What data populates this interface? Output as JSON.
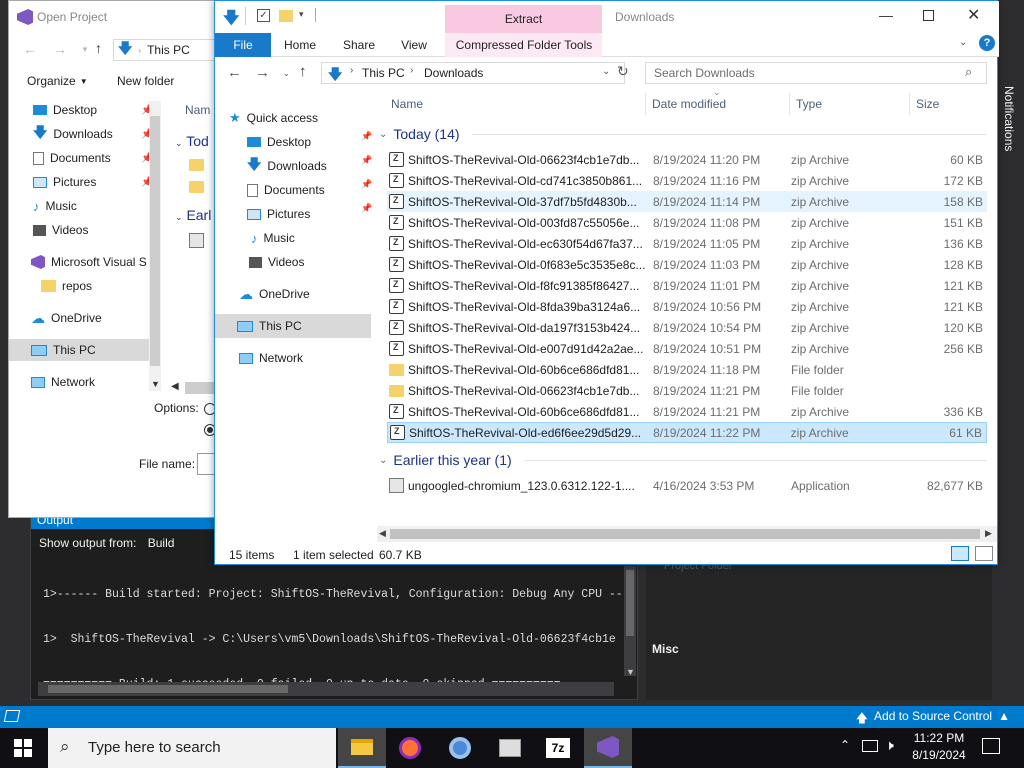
{
  "vs": {
    "output_title": "Output",
    "show_output_label": "Show output from:",
    "show_output_value": "Build",
    "output_lines": [
      "1>------ Build started: Project: ShiftOS-TheRevival, Configuration: Debug Any CPU ------",
      "1>  ShiftOS-TheRevival -> C:\\Users\\vm5\\Downloads\\ShiftOS-TheRevival-Old-06623f4cb1e",
      "========== Build: 1 succeeded, 0 failed, 0 up-to-date, 0 skipped =========="
    ],
    "props_misc": "Misc",
    "props_faded": "Project Folder",
    "status_source_control": "Add to Source Control",
    "notifications": "Notifications"
  },
  "open_project": {
    "title": "Open Project",
    "breadcrumb": "This PC",
    "organize": "Organize",
    "new_folder": "New folder",
    "nav": [
      {
        "label": "Desktop",
        "icon": "desktop-icon",
        "pinned": true
      },
      {
        "label": "Downloads",
        "icon": "downloads-icon",
        "pinned": true
      },
      {
        "label": "Documents",
        "icon": "documents-icon",
        "pinned": true
      },
      {
        "label": "Pictures",
        "icon": "pictures-icon",
        "pinned": true
      },
      {
        "label": "Music",
        "icon": "music-icon",
        "pinned": false
      },
      {
        "label": "Videos",
        "icon": "videos-icon",
        "pinned": false
      },
      {
        "label": "Microsoft Visual S",
        "icon": "visual-studio-icon",
        "pinned": false
      },
      {
        "label": "repos",
        "icon": "folder-icon",
        "pinned": false
      },
      {
        "label": "OneDrive",
        "icon": "onedrive-icon",
        "pinned": false
      },
      {
        "label": "This PC",
        "icon": "this-pc-icon",
        "pinned": false
      },
      {
        "label": "Network",
        "icon": "network-icon",
        "pinned": false
      }
    ],
    "col_name": "Nam",
    "group_today": "Tod",
    "group_earlier": "Earl",
    "options_label": "Options:",
    "file_name_label": "File name:"
  },
  "explorer": {
    "window_title": "Downloads",
    "extract_tab": "Extract",
    "tabs": [
      "File",
      "Home",
      "Share",
      "View",
      "Compressed Folder Tools"
    ],
    "address": [
      "This PC",
      "Downloads"
    ],
    "search_placeholder": "Search Downloads",
    "nav": [
      {
        "label": "Quick access",
        "icon": "star-icon"
      },
      {
        "label": "Desktop",
        "icon": "desktop-icon"
      },
      {
        "label": "Downloads",
        "icon": "downloads-icon"
      },
      {
        "label": "Documents",
        "icon": "documents-icon"
      },
      {
        "label": "Pictures",
        "icon": "pictures-icon"
      },
      {
        "label": "Music",
        "icon": "music-icon"
      },
      {
        "label": "Videos",
        "icon": "videos-icon"
      },
      {
        "label": "OneDrive",
        "icon": "onedrive-icon"
      },
      {
        "label": "This PC",
        "icon": "this-pc-icon"
      },
      {
        "label": "Network",
        "icon": "network-icon"
      }
    ],
    "columns": {
      "name": "Name",
      "date": "Date modified",
      "type": "Type",
      "size": "Size"
    },
    "group_today": "Today (14)",
    "group_earlier": "Earlier this year (1)",
    "files_today": [
      {
        "name": "ShiftOS-TheRevival-Old-06623f4cb1e7db...",
        "date": "8/19/2024 11:20 PM",
        "type": "zip Archive",
        "size": "60 KB",
        "kind": "zip"
      },
      {
        "name": "ShiftOS-TheRevival-Old-cd741c3850b861...",
        "date": "8/19/2024 11:16 PM",
        "type": "zip Archive",
        "size": "172 KB",
        "kind": "zip"
      },
      {
        "name": "ShiftOS-TheRevival-Old-37df7b5fd4830b...",
        "date": "8/19/2024 11:14 PM",
        "type": "zip Archive",
        "size": "158 KB",
        "kind": "zip"
      },
      {
        "name": "ShiftOS-TheRevival-Old-003fd87c55056e...",
        "date": "8/19/2024 11:08 PM",
        "type": "zip Archive",
        "size": "151 KB",
        "kind": "zip"
      },
      {
        "name": "ShiftOS-TheRevival-Old-ec630f54d67fa37...",
        "date": "8/19/2024 11:05 PM",
        "type": "zip Archive",
        "size": "136 KB",
        "kind": "zip"
      },
      {
        "name": "ShiftOS-TheRevival-Old-0f683e5c3535e8c...",
        "date": "8/19/2024 11:03 PM",
        "type": "zip Archive",
        "size": "128 KB",
        "kind": "zip"
      },
      {
        "name": "ShiftOS-TheRevival-Old-f8fc91385f86427...",
        "date": "8/19/2024 11:01 PM",
        "type": "zip Archive",
        "size": "121 KB",
        "kind": "zip"
      },
      {
        "name": "ShiftOS-TheRevival-Old-8fda39ba3124a6...",
        "date": "8/19/2024 10:56 PM",
        "type": "zip Archive",
        "size": "121 KB",
        "kind": "zip"
      },
      {
        "name": "ShiftOS-TheRevival-Old-da197f3153b424...",
        "date": "8/19/2024 10:54 PM",
        "type": "zip Archive",
        "size": "120 KB",
        "kind": "zip"
      },
      {
        "name": "ShiftOS-TheRevival-Old-e007d91d42a2ae...",
        "date": "8/19/2024 10:51 PM",
        "type": "zip Archive",
        "size": "256 KB",
        "kind": "zip"
      },
      {
        "name": "ShiftOS-TheRevival-Old-60b6ce686dfd81...",
        "date": "8/19/2024 11:18 PM",
        "type": "File folder",
        "size": "",
        "kind": "folder"
      },
      {
        "name": "ShiftOS-TheRevival-Old-06623f4cb1e7db...",
        "date": "8/19/2024 11:21 PM",
        "type": "File folder",
        "size": "",
        "kind": "folder"
      },
      {
        "name": "ShiftOS-TheRevival-Old-60b6ce686dfd81...",
        "date": "8/19/2024 11:21 PM",
        "type": "zip Archive",
        "size": "336 KB",
        "kind": "zip"
      },
      {
        "name": "ShiftOS-TheRevival-Old-ed6f6ee29d5d29...",
        "date": "8/19/2024 11:22 PM",
        "type": "zip Archive",
        "size": "61 KB",
        "kind": "zip"
      }
    ],
    "files_earlier": [
      {
        "name": "ungoogled-chromium_123.0.6312.122-1....",
        "date": "4/16/2024 3:53 PM",
        "type": "Application",
        "size": "82,677 KB",
        "kind": "app"
      }
    ],
    "status_items": "15 items",
    "status_selected": "1 item selected",
    "status_size": "60.7 KB"
  },
  "taskbar": {
    "search_placeholder": "Type here to search",
    "time": "11:22 PM",
    "date": "8/19/2024"
  },
  "colors": {
    "vs_blue": "#007acc",
    "explorer_accent": "#1979ca",
    "extract_pink": "#f9c9e2",
    "selection": "#cce8ff"
  }
}
